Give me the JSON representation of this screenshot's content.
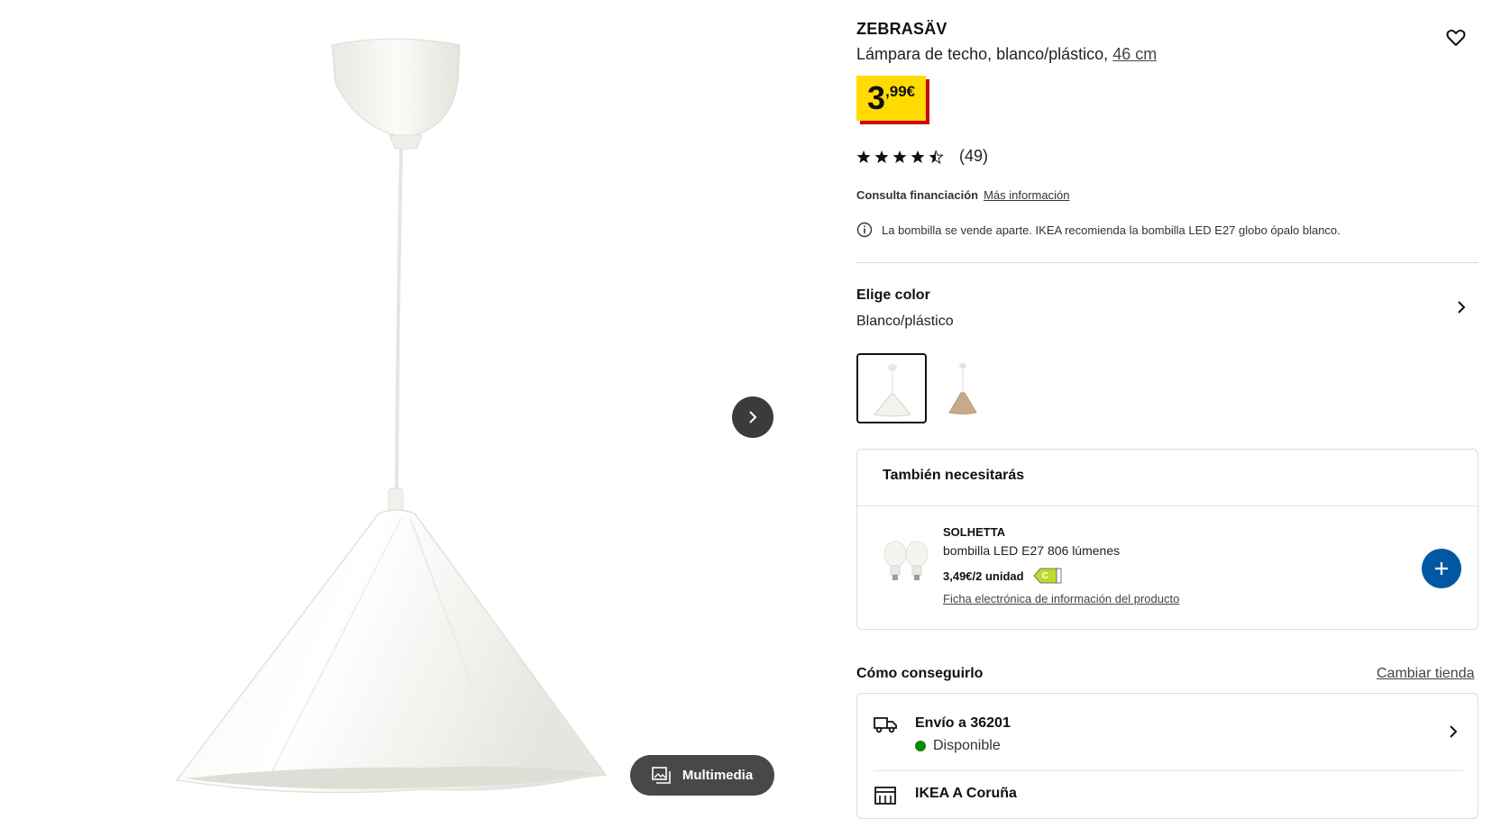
{
  "product": {
    "name": "ZEBRASÄV",
    "description": "Lámpara de techo, blanco/plástico, ",
    "measure": "46 cm",
    "price_int": "3",
    "price_dec": ",99€",
    "rating_value": 4.5,
    "rating_max": 5,
    "rating_count": "(49)",
    "finance_label": "Consulta financiación",
    "finance_link": "Más información",
    "info_note": "La bombilla se vende aparte. IKEA recomienda la bombilla LED E27 globo ópalo blanco."
  },
  "gallery": {
    "multimedia_label": "Multimedia"
  },
  "color": {
    "title": "Elige color",
    "value": "Blanco/plástico"
  },
  "needs": {
    "title": "También necesitarás",
    "item": {
      "name": "SOLHETTA",
      "desc": "bombilla LED E27 806 lúmenes",
      "price": "3,49€/2 unidad",
      "energy_class": "C",
      "link": "Ficha electrónica de información del producto"
    }
  },
  "get": {
    "title": "Cómo conseguirlo",
    "change_store": "Cambiar tienda",
    "delivery_title": "Envío a 36201",
    "delivery_status": "Disponible",
    "store_title": "IKEA A Coruña"
  },
  "colors": {
    "price_bg": "#ffdb00",
    "price_shadow": "#cc0008",
    "accent_blue": "#0058a3",
    "available_green": "#0a8a00"
  }
}
